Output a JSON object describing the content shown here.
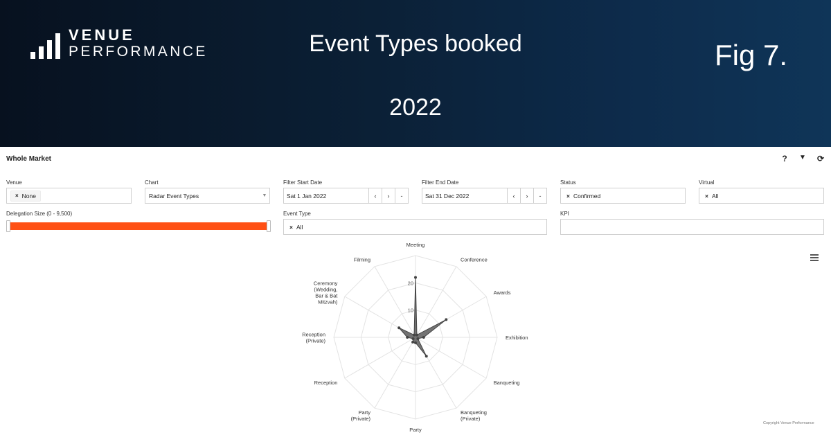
{
  "banner": {
    "logo_line1": "VENUE",
    "logo_line2": "PERFORMANCE",
    "title": "Event Types booked",
    "year": "2022",
    "fig": "Fig 7."
  },
  "panel": {
    "title": "Whole Market",
    "tools": {
      "help": "?",
      "filter": "▼",
      "refresh": "⟳"
    }
  },
  "filters": {
    "venue": {
      "label": "Venue",
      "value": "None"
    },
    "chart": {
      "label": "Chart",
      "value": "Radar Event Types"
    },
    "start_date": {
      "label": "Filter Start Date",
      "value": "Sat 1 Jan 2022",
      "prev": "‹",
      "next": "›",
      "clear": "-"
    },
    "end_date": {
      "label": "Filter End Date",
      "value": "Sat 31 Dec 2022",
      "prev": "‹",
      "next": "›",
      "clear": "-"
    },
    "status": {
      "label": "Status",
      "value": "Confirmed"
    },
    "virtual": {
      "label": "Virtual",
      "value": "All"
    },
    "delegation": {
      "label": "Delegation Size (0 - 9,500)",
      "range_min": 0,
      "range_max": 9500,
      "selected_min_fraction": 0,
      "selected_max_fraction": 1
    },
    "event_type": {
      "label": "Event Type",
      "value": "All"
    },
    "kpi": {
      "label": "KPI",
      "value": ""
    }
  },
  "remove_glyph": "×",
  "accent_color": "#ff5014",
  "copyright": "Copyright Venue Performance",
  "chart_data": {
    "type": "radar",
    "categories": [
      "Meeting",
      "Conference",
      "Awards",
      "Exhibition",
      "Banqueting",
      "Banqueting (Private)",
      "Party",
      "Party (Private)",
      "Reception",
      "Reception (Private)",
      "Ceremony (Wedding, Bar & Bat Mitzvah)",
      "Filming"
    ],
    "values": [
      22,
      1,
      13,
      3,
      1,
      8,
      2,
      2,
      1,
      3,
      7,
      1
    ],
    "rlim": [
      0,
      30
    ],
    "ticks": [
      10,
      20
    ],
    "grid": true,
    "fill_color": "#6b6b6b",
    "line_color": "#444444"
  }
}
